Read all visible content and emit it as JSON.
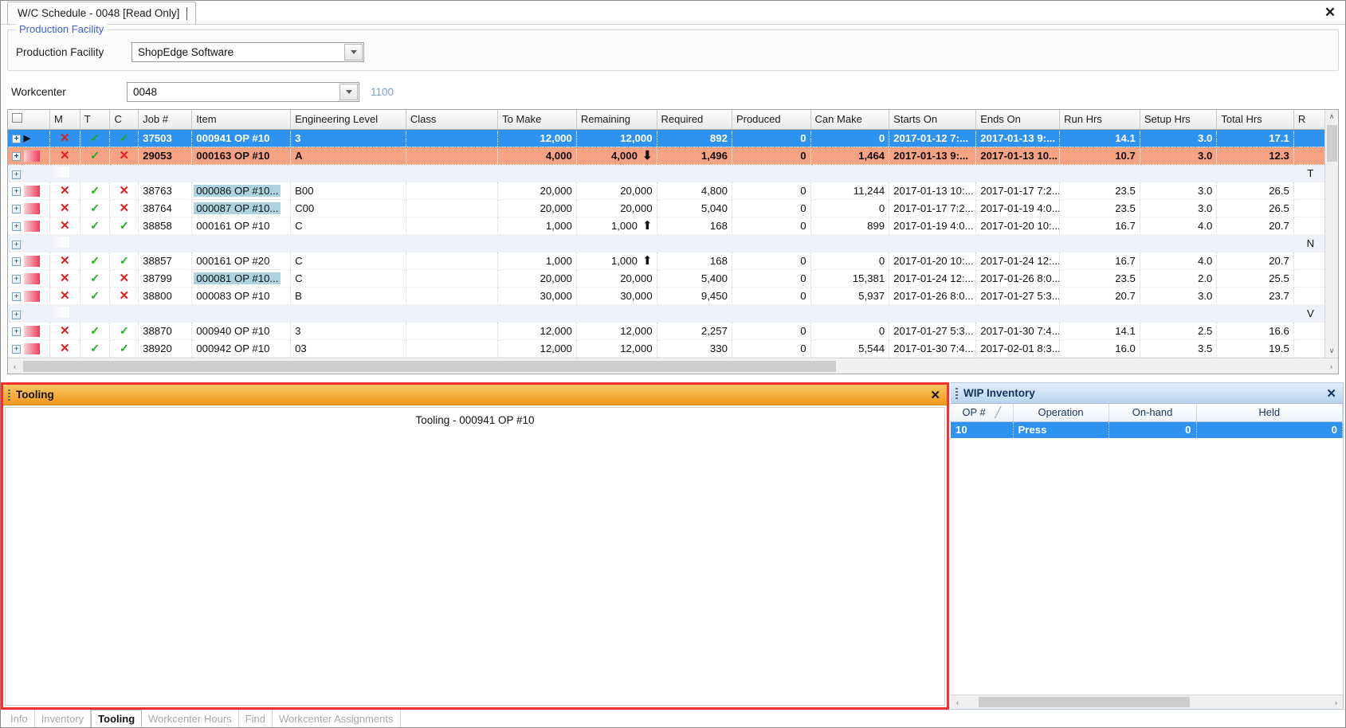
{
  "window": {
    "tab_title": "W/C Schedule - 0048 [Read Only]",
    "close_label": "✕"
  },
  "facility_group": {
    "legend": "Production Facility",
    "field_label": "Production Facility",
    "value": "ShopEdge Software"
  },
  "workcenter": {
    "label": "Workcenter",
    "value": "0048",
    "extra": "1100"
  },
  "grid": {
    "columns": [
      "",
      "M",
      "T",
      "C",
      "Job #",
      "Item",
      "Engineering Level",
      "Class",
      "To Make",
      "Remaining",
      "Required",
      "Produced",
      "Can Make",
      "Starts On",
      "Ends On",
      "Run Hrs",
      "Setup Hrs",
      "Total Hrs",
      "R"
    ],
    "rows": [
      {
        "kind": "selected",
        "pointer": "▶",
        "m": "✕",
        "t": "✓",
        "c": "✓",
        "job": "37503",
        "item": "000941 OP #10",
        "item_hl": false,
        "eng": "3",
        "class": "",
        "to_make": "12,000",
        "remaining": "12,000",
        "rem_arrow": "",
        "required": "892",
        "produced": "0",
        "can_make": "0",
        "starts_on": "2017-01-12 7:...",
        "ends_on": "2017-01-13 9:...",
        "run_hrs": "14.1",
        "setup_hrs": "3.0",
        "total_hrs": "17.1",
        "r": ""
      },
      {
        "kind": "orange",
        "pointer": "",
        "m": "✕",
        "t": "✓",
        "c": "✕",
        "job": "29053",
        "item": "000163 OP #10",
        "item_hl": false,
        "eng": "A",
        "class": "",
        "to_make": "4,000",
        "remaining": "4,000",
        "rem_arrow": "⬇",
        "required": "1,496",
        "produced": "0",
        "can_make": "1,464",
        "starts_on": "2017-01-13 9:...",
        "ends_on": "2017-01-13 10...",
        "run_hrs": "10.7",
        "setup_hrs": "3.0",
        "total_hrs": "12.3",
        "r": ""
      },
      {
        "kind": "blank",
        "r": "T"
      },
      {
        "kind": "normal",
        "pointer": "",
        "m": "✕",
        "t": "✓",
        "c": "✕",
        "job": "38763",
        "item": "000086 OP #10...",
        "item_hl": true,
        "eng": "B00",
        "class": "",
        "to_make": "20,000",
        "remaining": "20,000",
        "rem_arrow": "",
        "required": "4,800",
        "produced": "0",
        "can_make": "11,244",
        "starts_on": "2017-01-13 10:...",
        "ends_on": "2017-01-17 7:2...",
        "run_hrs": "23.5",
        "setup_hrs": "3.0",
        "total_hrs": "26.5",
        "r": ""
      },
      {
        "kind": "normal",
        "pointer": "",
        "m": "✕",
        "t": "✓",
        "c": "✕",
        "job": "38764",
        "item": "000087 OP #10...",
        "item_hl": true,
        "eng": "C00",
        "class": "",
        "to_make": "20,000",
        "remaining": "20,000",
        "rem_arrow": "",
        "required": "5,040",
        "produced": "0",
        "can_make": "0",
        "starts_on": "2017-01-17 7:2...",
        "ends_on": "2017-01-19 4:0...",
        "run_hrs": "23.5",
        "setup_hrs": "3.0",
        "total_hrs": "26.5",
        "r": ""
      },
      {
        "kind": "normal",
        "pointer": "",
        "m": "✕",
        "t": "✓",
        "c": "✓",
        "job": "38858",
        "item": "000161 OP #10",
        "item_hl": false,
        "eng": "C",
        "class": "",
        "to_make": "1,000",
        "remaining": "1,000",
        "rem_arrow": "⬆",
        "required": "168",
        "produced": "0",
        "can_make": "899",
        "starts_on": "2017-01-19 4:0...",
        "ends_on": "2017-01-20 10:...",
        "run_hrs": "16.7",
        "setup_hrs": "4.0",
        "total_hrs": "20.7",
        "r": ""
      },
      {
        "kind": "blank",
        "r": "N"
      },
      {
        "kind": "normal",
        "pointer": "",
        "m": "✕",
        "t": "✓",
        "c": "✓",
        "job": "38857",
        "item": "000161 OP #20",
        "item_hl": false,
        "eng": "C",
        "class": "",
        "to_make": "1,000",
        "remaining": "1,000",
        "rem_arrow": "⬆",
        "required": "168",
        "produced": "0",
        "can_make": "0",
        "starts_on": "2017-01-20 10:...",
        "ends_on": "2017-01-24 12:...",
        "run_hrs": "16.7",
        "setup_hrs": "4.0",
        "total_hrs": "20.7",
        "r": ""
      },
      {
        "kind": "normal",
        "pointer": "",
        "m": "✕",
        "t": "✓",
        "c": "✕",
        "job": "38799",
        "item": "000081 OP #10...",
        "item_hl": true,
        "eng": "C",
        "class": "",
        "to_make": "20,000",
        "remaining": "20,000",
        "rem_arrow": "",
        "required": "5,400",
        "produced": "0",
        "can_make": "15,381",
        "starts_on": "2017-01-24 12:...",
        "ends_on": "2017-01-26 8:0...",
        "run_hrs": "23.5",
        "setup_hrs": "2.0",
        "total_hrs": "25.5",
        "r": ""
      },
      {
        "kind": "normal",
        "pointer": "",
        "m": "✕",
        "t": "✓",
        "c": "✕",
        "job": "38800",
        "item": "000083 OP #10",
        "item_hl": false,
        "eng": "B",
        "class": "",
        "to_make": "30,000",
        "remaining": "30,000",
        "rem_arrow": "",
        "required": "9,450",
        "produced": "0",
        "can_make": "5,937",
        "starts_on": "2017-01-26 8:0...",
        "ends_on": "2017-01-27 5:3...",
        "run_hrs": "20.7",
        "setup_hrs": "3.0",
        "total_hrs": "23.7",
        "r": ""
      },
      {
        "kind": "blank",
        "r": "V"
      },
      {
        "kind": "normal",
        "pointer": "",
        "m": "✕",
        "t": "✓",
        "c": "✓",
        "job": "38870",
        "item": "000940 OP #10",
        "item_hl": false,
        "eng": "3",
        "class": "",
        "to_make": "12,000",
        "remaining": "12,000",
        "rem_arrow": "",
        "required": "2,257",
        "produced": "0",
        "can_make": "0",
        "starts_on": "2017-01-27 5:3...",
        "ends_on": "2017-01-30 7:4...",
        "run_hrs": "14.1",
        "setup_hrs": "2.5",
        "total_hrs": "16.6",
        "r": ""
      },
      {
        "kind": "normal",
        "pointer": "",
        "m": "✕",
        "t": "✓",
        "c": "✓",
        "job": "38920",
        "item": "000942 OP #10",
        "item_hl": false,
        "eng": "03",
        "class": "",
        "to_make": "12,000",
        "remaining": "12,000",
        "rem_arrow": "",
        "required": "330",
        "produced": "0",
        "can_make": "5,544",
        "starts_on": "2017-01-30 7:4...",
        "ends_on": "2017-02-01 8:3...",
        "run_hrs": "16.0",
        "setup_hrs": "3.5",
        "total_hrs": "19.5",
        "r": ""
      }
    ]
  },
  "tooling_panel": {
    "title": "Tooling",
    "close_label": "✕",
    "content_header": "Tooling - 000941 OP #10"
  },
  "wip_panel": {
    "title": "WIP Inventory",
    "close_label": "✕",
    "columns": [
      "OP #",
      "Operation",
      "On-hand",
      "Held"
    ],
    "sort_glyph": "╱",
    "rows": [
      {
        "op": "10",
        "operation": "Press",
        "on_hand": "0",
        "held": "0"
      }
    ]
  },
  "bottom_tabs": [
    {
      "label": "Info",
      "active": false
    },
    {
      "label": "Inventory",
      "active": false
    },
    {
      "label": "Tooling",
      "active": true
    },
    {
      "label": "Workcenter Hours",
      "active": false
    },
    {
      "label": "Find",
      "active": false
    },
    {
      "label": "Workcenter Assignments",
      "active": false
    }
  ],
  "scroll": {
    "up_arrow": "∧",
    "down_arrow": "∨",
    "left_arrow": "‹",
    "right_arrow": "›"
  },
  "colors": {
    "selection_blue": "#2e93f0",
    "warn_orange": "#f6a283",
    "alert_red": "#fb2e2e",
    "caption_orange": "#f2981f",
    "link_blue": "#3b5fd0"
  }
}
